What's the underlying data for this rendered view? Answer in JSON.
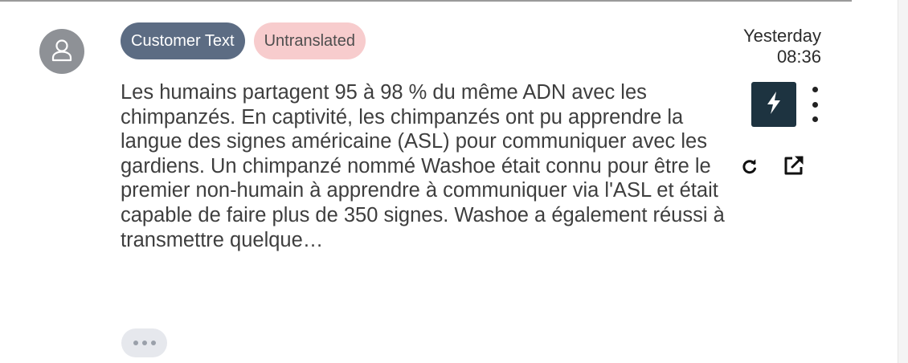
{
  "message": {
    "badges": {
      "type": "Customer Text",
      "status": "Untranslated"
    },
    "timestamp": {
      "day": "Yesterday",
      "time": "08:36"
    },
    "text": "Les humains partagent 95 à 98 % du même ADN avec les chimpanzés. En captivité, les chimpanzés ont pu apprendre la langue des signes américaine (ASL) pour communiquer avec les gardiens. Un chimpanzé nommé Washoe était connu pour être le premier non-humain à apprendre à communiquer via l'ASL et était capable de faire plus de 350 signes. Washoe a également réussi à transmettre quelque…"
  },
  "icons": {
    "avatar": "user-icon",
    "quick_action": "lightning-bolt-icon",
    "more": "vertical-ellipsis-icon",
    "refresh": "refresh-icon",
    "open_external": "external-link-icon",
    "expand": "horizontal-ellipsis-icon"
  },
  "colors": {
    "type_badge_bg": "#5c6c83",
    "status_badge_bg": "#f7cccd",
    "quick_action_bg": "#1d3340",
    "avatar_bg": "#8e9196"
  }
}
